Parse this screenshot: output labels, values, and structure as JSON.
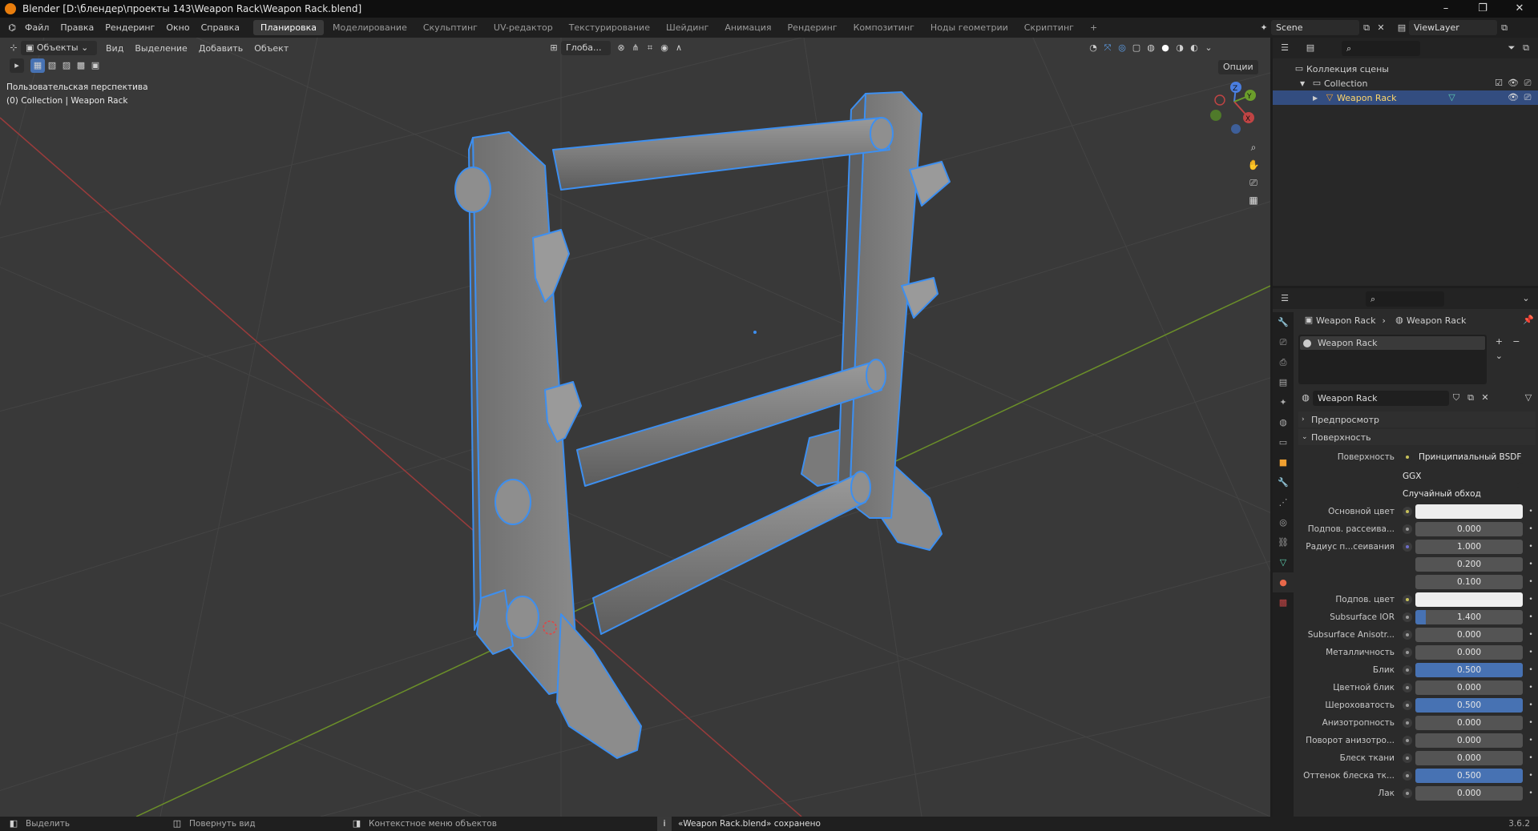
{
  "window": {
    "title": "Blender [D:\\блендер\\проекты 143\\Weapon Rack\\Weapon Rack.blend]",
    "controls": [
      "–",
      "❐",
      "✕"
    ]
  },
  "menu": {
    "items": [
      "Файл",
      "Правка",
      "Рендеринг",
      "Окно",
      "Справка"
    ],
    "workspaces": [
      "Планировка",
      "Моделирование",
      "Скульптинг",
      "UV-редактор",
      "Текстурирование",
      "Шейдинг",
      "Анимация",
      "Рендеринг",
      "Композитинг",
      "Ноды геометрии",
      "Скриптинг"
    ],
    "active_workspace": "Планировка",
    "add_workspace": "+",
    "scene": "Scene",
    "view_layer": "ViewLayer"
  },
  "viewport": {
    "mode": "Объекты",
    "menus": [
      "Вид",
      "Выделение",
      "Добавить",
      "Объект"
    ],
    "transform_orientation": "Глоба...",
    "options": "Опции",
    "overlay_title": "Пользовательская перспектива",
    "overlay_sub": "(0) Collection | Weapon Rack",
    "gizmo": {
      "x": "X",
      "y": "Y",
      "z": "Z"
    }
  },
  "outliner": {
    "root": "Коллекция сцены",
    "collection": "Collection",
    "object": "Weapon Rack"
  },
  "properties": {
    "breadcrumb_object": "Weapon Rack",
    "breadcrumb_material": "Weapon Rack",
    "slot": "Weapon Rack",
    "material_name": "Weapon Rack",
    "panel_preview": "Предпросмотр",
    "panel_surface": "Поверхность",
    "surface_label": "Поверхность",
    "surface_shader": "Принципиальный BSDF",
    "distribution": "GGX",
    "subsurface_method": "Случайный обход",
    "rows": [
      {
        "label": "Основной цвет",
        "value": "",
        "type": "color",
        "dot": "yellow"
      },
      {
        "label": "Подпов. рассеива...",
        "value": "0.000",
        "type": "num",
        "fill": 0,
        "dot": "grey"
      },
      {
        "label": "Радиус п...сеивания",
        "value": "1.000",
        "type": "num",
        "fill": 0,
        "dot": "blue"
      },
      {
        "label": "",
        "value": "0.200",
        "type": "num",
        "fill": 0,
        "dot": "none"
      },
      {
        "label": "",
        "value": "0.100",
        "type": "num",
        "fill": 0,
        "dot": "none"
      },
      {
        "label": "Подпов. цвет",
        "value": "",
        "type": "color",
        "dot": "yellow"
      },
      {
        "label": "Subsurface IOR",
        "value": "1.400",
        "type": "num",
        "fill": 0.1,
        "dot": "grey"
      },
      {
        "label": "Subsurface Anisotr...",
        "value": "0.000",
        "type": "num",
        "fill": 0,
        "dot": "grey"
      },
      {
        "label": "Металличность",
        "value": "0.000",
        "type": "num",
        "fill": 0,
        "dot": "grey"
      },
      {
        "label": "Блик",
        "value": "0.500",
        "type": "num",
        "fill": 1,
        "dot": "grey"
      },
      {
        "label": "Цветной блик",
        "value": "0.000",
        "type": "num",
        "fill": 0,
        "dot": "grey"
      },
      {
        "label": "Шероховатость",
        "value": "0.500",
        "type": "num",
        "fill": 1,
        "dot": "grey"
      },
      {
        "label": "Анизотропность",
        "value": "0.000",
        "type": "num",
        "fill": 0,
        "dot": "grey"
      },
      {
        "label": "Поворот анизотро...",
        "value": "0.000",
        "type": "num",
        "fill": 0,
        "dot": "grey"
      },
      {
        "label": "Блеск ткани",
        "value": "0.000",
        "type": "num",
        "fill": 0,
        "dot": "grey"
      },
      {
        "label": "Оттенок блеска тк...",
        "value": "0.500",
        "type": "num",
        "fill": 1,
        "dot": "grey"
      },
      {
        "label": "Лак",
        "value": "0.000",
        "type": "num",
        "fill": 0,
        "dot": "grey"
      }
    ]
  },
  "status": {
    "select": "Выделить",
    "rotate": "Повернуть вид",
    "context": "Контекстное меню объектов",
    "message": "«Weapon Rack.blend» сохранено",
    "version": "3.6.2"
  },
  "colors": {
    "selection_outline": "#3d8ff0",
    "accent": "#4772b3",
    "x_axis": "#b03a3a",
    "y_axis": "#6b8f29"
  }
}
